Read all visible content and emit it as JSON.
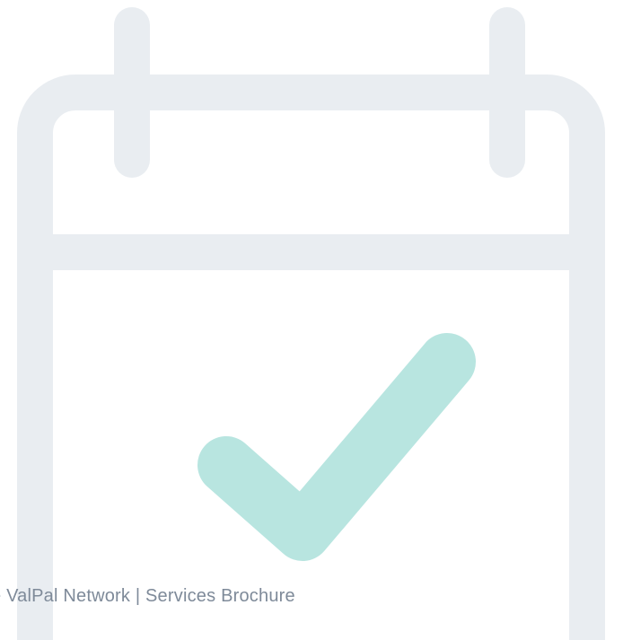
{
  "footer": {
    "text": "e ValPal Network  |  Services Brochure"
  },
  "graphic": {
    "icon": "calendar-check-icon",
    "calendar_color": "#e9edf1",
    "check_color": "#b8e5e0",
    "background_color": "#ffffff"
  }
}
